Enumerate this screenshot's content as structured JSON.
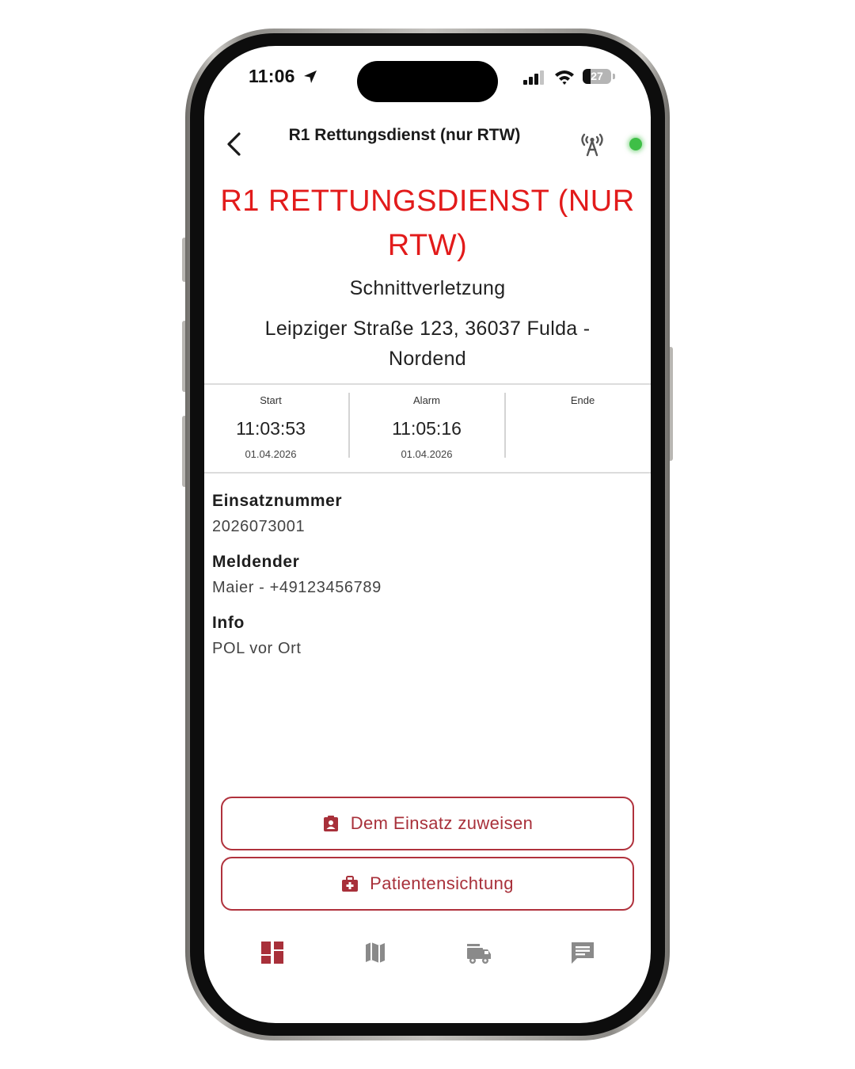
{
  "colors": {
    "accent": "#e21b1b",
    "button": "#a8303a",
    "tab_active": "#a8303a",
    "tab_inactive": "#8a8a8a",
    "status_online": "#3fbf47"
  },
  "status_bar": {
    "time": "11:06",
    "battery": "27",
    "battery_level": 0.27,
    "icons": [
      "location-arrow-icon",
      "cellular-signal-icon",
      "wifi-icon",
      "battery-icon"
    ]
  },
  "nav": {
    "title": "R1 Rettungsdienst (nur RTW)",
    "back_icon": "chevron-left-icon",
    "radio_icon": "radio-tower-icon",
    "status": "online"
  },
  "mission": {
    "title": "R1 RETTUNGSDIENST (NUR RTW)",
    "keyword": "Schnittverletzung",
    "address": "Leipziger Straße 123, 36037 Fulda - Nordend"
  },
  "times": {
    "start": {
      "label": "Start",
      "time": "11:03:53",
      "date": "01.04.2026"
    },
    "alarm": {
      "label": "Alarm",
      "time": "11:05:16",
      "date": "01.04.2026"
    },
    "end": {
      "label": "Ende",
      "time": "",
      "date": ""
    }
  },
  "details": {
    "number": {
      "label": "Einsatznummer",
      "value": "2026073001"
    },
    "reporter": {
      "label": "Meldender",
      "value": "Maier - +49123456789"
    },
    "info": {
      "label": "Info",
      "value": "POL vor Ort"
    }
  },
  "actions": {
    "assign": {
      "label": "Dem Einsatz zuweisen",
      "icon": "clipboard-person-icon"
    },
    "patient": {
      "label": "Patientensichtung",
      "icon": "medical-bag-icon"
    }
  },
  "tabs": [
    {
      "name": "dashboard",
      "icon": "dashboard-icon",
      "active": true
    },
    {
      "name": "map",
      "icon": "map-icon",
      "active": false
    },
    {
      "name": "vehicles",
      "icon": "fire-truck-icon",
      "active": false
    },
    {
      "name": "messages",
      "icon": "message-icon",
      "active": false
    }
  ]
}
